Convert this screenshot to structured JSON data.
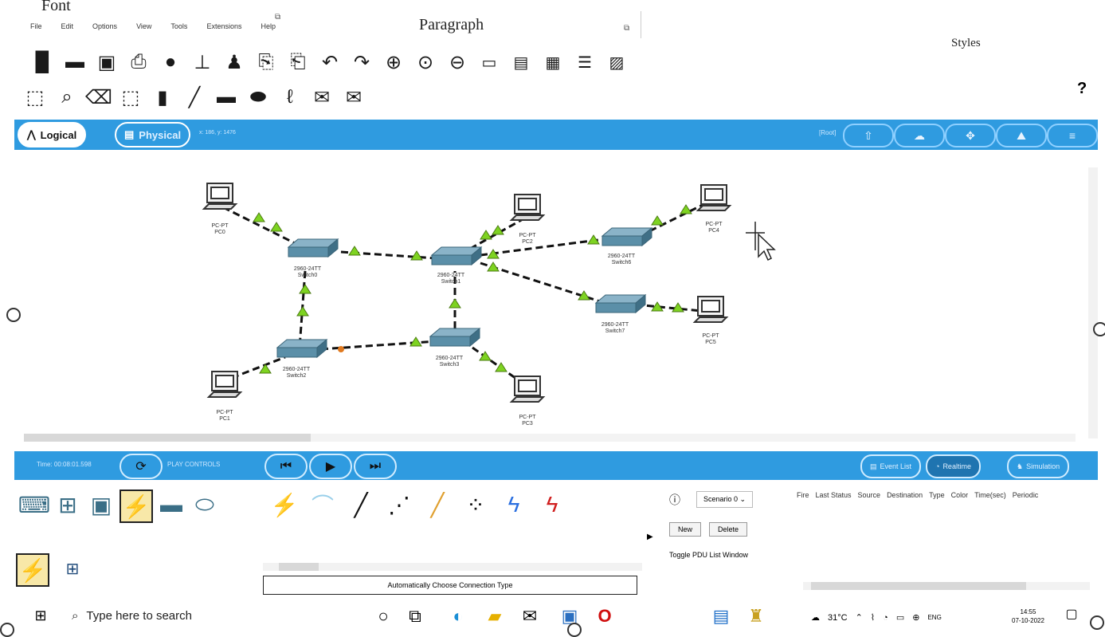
{
  "ribbon": {
    "font_label": "Font",
    "paragraph_label": "Paragraph",
    "styles_label": "Styles",
    "help_mark": "?"
  },
  "menu": [
    "File",
    "Edit",
    "Options",
    "View",
    "Tools",
    "Extensions",
    "Help"
  ],
  "mode": {
    "logical": "Logical",
    "physical": "Physical",
    "coords": "x: 186, y: 1476",
    "root": "[Root]"
  },
  "devices": {
    "pcs": [
      {
        "type": "PC-PT",
        "name": "PC0"
      },
      {
        "type": "PC-PT",
        "name": "PC1"
      },
      {
        "type": "PC-PT",
        "name": "PC2"
      },
      {
        "type": "PC-PT",
        "name": "PC3"
      },
      {
        "type": "PC-PT",
        "name": "PC4"
      },
      {
        "type": "PC-PT",
        "name": "PC5"
      }
    ],
    "switches": [
      {
        "type": "2960-24TT",
        "name": "Switch0"
      },
      {
        "type": "2960-24TT",
        "name": "Switch1"
      },
      {
        "type": "2960-24TT",
        "name": "Switch2"
      },
      {
        "type": "2960-24TT",
        "name": "Switch3"
      },
      {
        "type": "2960-24TT",
        "name": "Switch6"
      },
      {
        "type": "2960-24TT",
        "name": "Switch7"
      }
    ]
  },
  "playbar": {
    "time": "Time: 00:08:01.598",
    "play_controls": "PLAY CONTROLS",
    "event_list": "Event List",
    "realtime": "Realtime",
    "simulation": "Simulation"
  },
  "bottom": {
    "connection_type": "Automatically Choose Connection Type",
    "scenario": "Scenario 0",
    "new_btn": "New",
    "delete_btn": "Delete",
    "toggle_pdu": "Toggle PDU List Window",
    "pdu_columns": [
      "Fire",
      "Last Status",
      "Source",
      "Destination",
      "Type",
      "Color",
      "Time(sec)",
      "Periodic"
    ]
  },
  "taskbar": {
    "search_placeholder": "Type here to search",
    "temperature": "31°C",
    "lang": "ENG",
    "time": "14:55",
    "date": "07-10-2022"
  },
  "colors": {
    "accent_blue": "#2f9be0",
    "link_green": "#7ed321",
    "link_orange": "#e07a20",
    "switch_teal": "#5b8fa8"
  }
}
